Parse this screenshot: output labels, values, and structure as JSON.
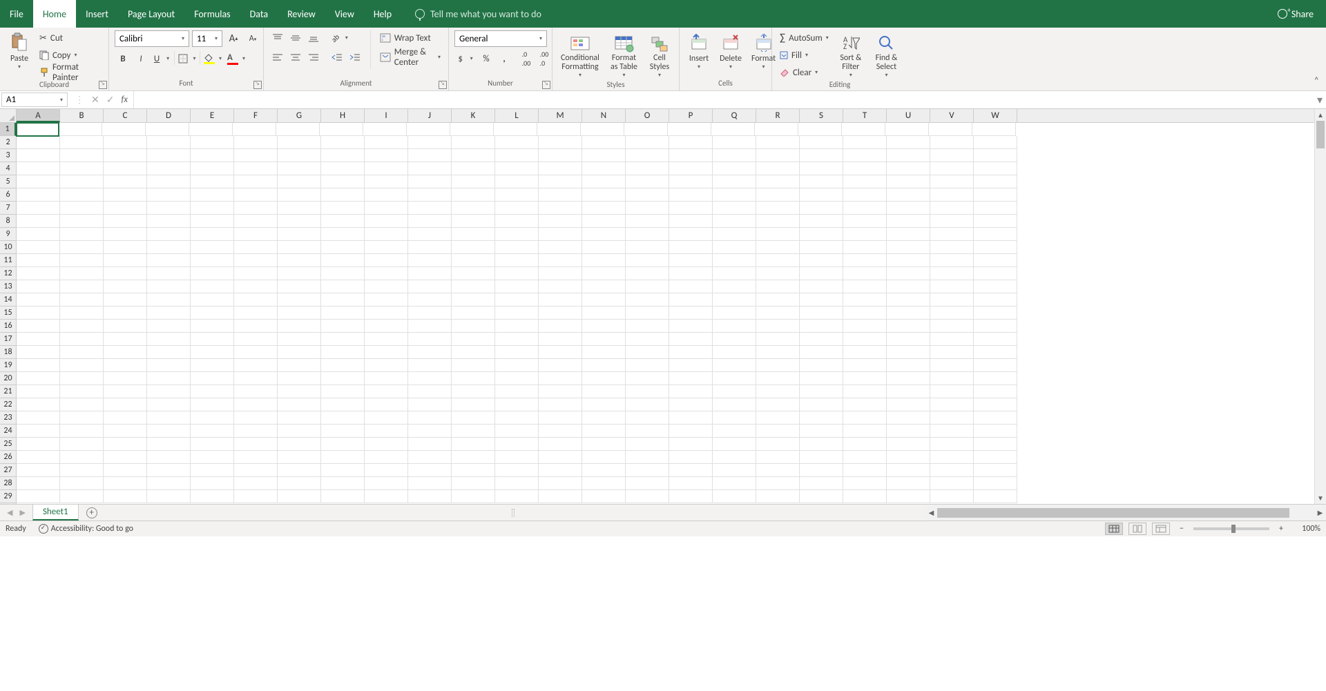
{
  "tabs": [
    "File",
    "Home",
    "Insert",
    "Page Layout",
    "Formulas",
    "Data",
    "Review",
    "View",
    "Help"
  ],
  "active_tab": "Home",
  "tell_me": "Tell me what you want to do",
  "share": "Share",
  "ribbon": {
    "clipboard": {
      "paste": "Paste",
      "cut": "Cut",
      "copy": "Copy",
      "format_painter": "Format Painter",
      "label": "Clipboard"
    },
    "font": {
      "name": "Calibri",
      "size": "11",
      "label": "Font"
    },
    "alignment": {
      "wrap": "Wrap Text",
      "merge": "Merge & Center",
      "label": "Alignment"
    },
    "number": {
      "format": "General",
      "label": "Number"
    },
    "styles": {
      "cond": "Conditional Formatting",
      "table": "Format as Table",
      "cell": "Cell Styles",
      "label": "Styles"
    },
    "cells": {
      "insert": "Insert",
      "delete": "Delete",
      "format": "Format",
      "label": "Cells"
    },
    "editing": {
      "autosum": "AutoSum",
      "fill": "Fill",
      "clear": "Clear",
      "sort": "Sort & Filter",
      "find": "Find & Select",
      "label": "Editing"
    }
  },
  "name_box": "A1",
  "formula": "",
  "columns": [
    "A",
    "B",
    "C",
    "D",
    "E",
    "F",
    "G",
    "H",
    "I",
    "J",
    "K",
    "L",
    "M",
    "N",
    "O",
    "P",
    "Q",
    "R",
    "S",
    "T",
    "U",
    "V",
    "W"
  ],
  "rows": [
    1,
    2,
    3,
    4,
    5,
    6,
    7,
    8,
    9,
    10,
    11,
    12,
    13,
    14,
    15,
    16,
    17,
    18,
    19,
    20,
    21,
    22,
    23,
    24,
    25,
    26,
    27,
    28,
    29
  ],
  "active_cell": {
    "col": 0,
    "row": 0
  },
  "sheet_tab": "Sheet1",
  "status": {
    "ready": "Ready",
    "accessibility": "Accessibility: Good to go",
    "zoom": "100%"
  }
}
